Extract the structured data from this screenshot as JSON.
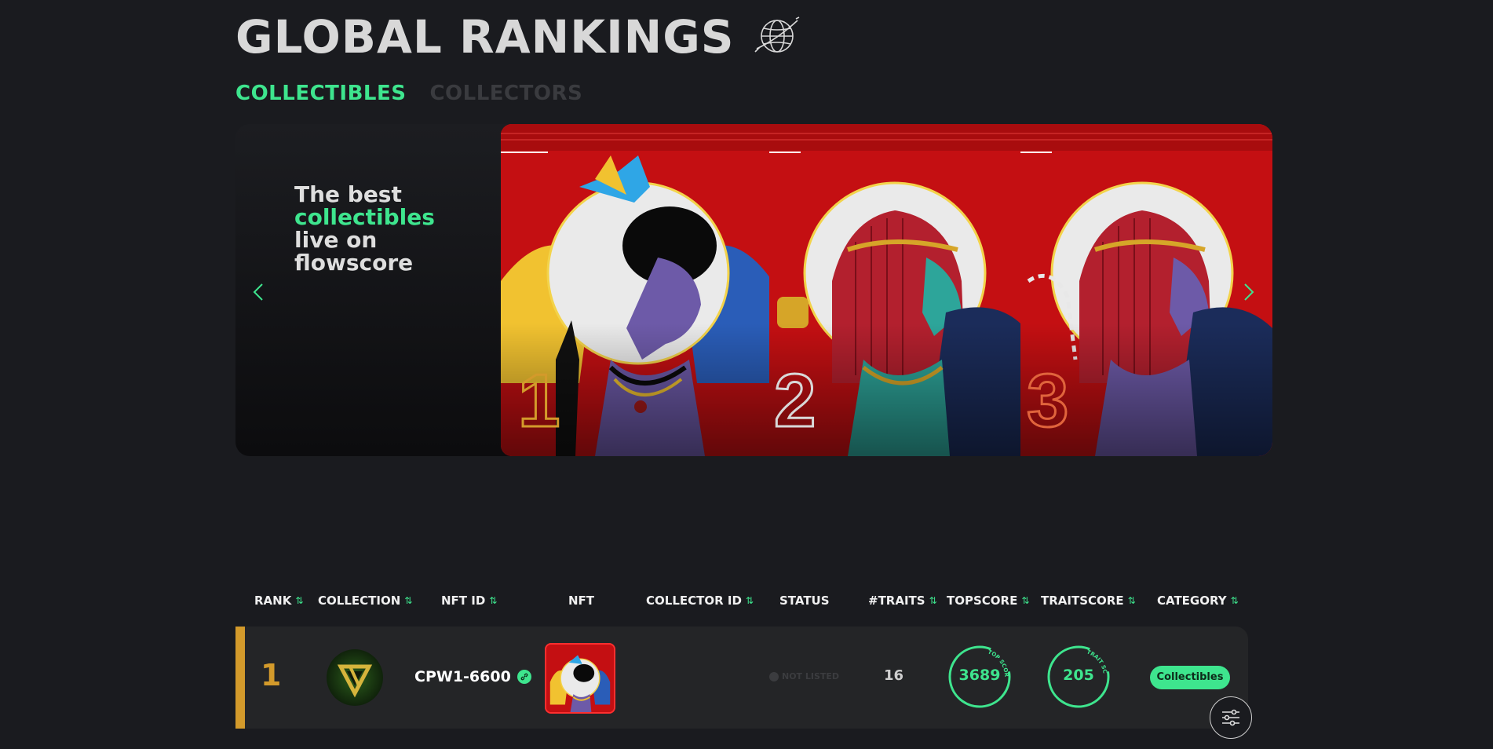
{
  "header": {
    "title": "GLOBAL RANKINGS",
    "globe_icon": "globe-icon"
  },
  "tabs": [
    {
      "label": "COLLECTIBLES",
      "active": true
    },
    {
      "label": "COLLECTORS",
      "active": false
    }
  ],
  "hero": {
    "line1": "The best",
    "line2": "collectibles",
    "line3": "live on",
    "line4": "flowscore",
    "cards": [
      {
        "rank": "1",
        "rank_color": "#d39a2b"
      },
      {
        "rank": "2",
        "rank_color": "#d8d8d8"
      },
      {
        "rank": "3",
        "rank_color": "#e0643c"
      }
    ]
  },
  "table": {
    "columns": [
      {
        "label": "RANK",
        "sortable": true
      },
      {
        "label": "COLLECTION",
        "sortable": true
      },
      {
        "label": "NFT ID",
        "sortable": true
      },
      {
        "label": "NFT",
        "sortable": false
      },
      {
        "label": "COLLECTOR ID",
        "sortable": true
      },
      {
        "label": "STATUS",
        "sortable": false
      },
      {
        "label": "#TRAITS",
        "sortable": true
      },
      {
        "label": "TOPSCORE",
        "sortable": true
      },
      {
        "label": "TRAITSCORE",
        "sortable": true
      },
      {
        "label": "CATEGORY",
        "sortable": true
      }
    ],
    "sort_glyph": "⇅",
    "rows": [
      {
        "rank": "1",
        "nft_id": "CPW1-6600",
        "collector_id": "",
        "status": "NOT LISTED",
        "traits": "16",
        "topscore": "3689",
        "topscore_label": "TOP SCORE",
        "traitscore": "205",
        "traitscore_label": "TRAIT SCORE",
        "category": "Collectibles"
      }
    ]
  },
  "colors": {
    "accent": "#3ee58e",
    "gold": "#d39a2b",
    "card_red": "#c40f12",
    "background": "#1a1b1f"
  }
}
